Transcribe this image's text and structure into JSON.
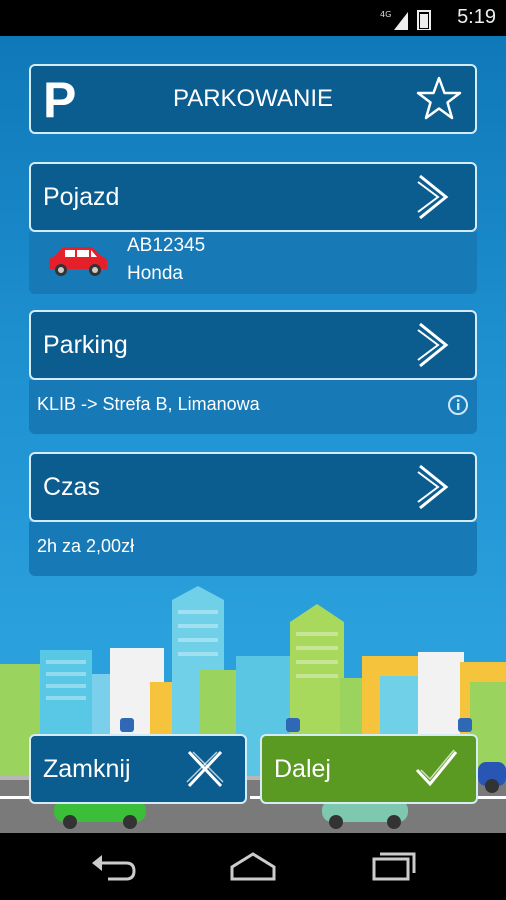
{
  "status_bar": {
    "network_label": "4G",
    "time": "5:19"
  },
  "header": {
    "logo_letter": "P",
    "title": "PARKOWANIE",
    "favorite_icon": "star-icon"
  },
  "vehicle": {
    "label": "Pojazd",
    "plate": "AB12345",
    "brand": "Honda",
    "car_color": "#e5202a"
  },
  "parking": {
    "label": "Parking",
    "location": "KLIB -> Strefa B, Limanowa"
  },
  "time": {
    "label": "Czas",
    "summary": "2h za 2,00zł"
  },
  "actions": {
    "close_label": "Zamknij",
    "next_label": "Dalej"
  },
  "colors": {
    "panel": "#0b5c8f",
    "accent_green": "#5a9a23"
  }
}
